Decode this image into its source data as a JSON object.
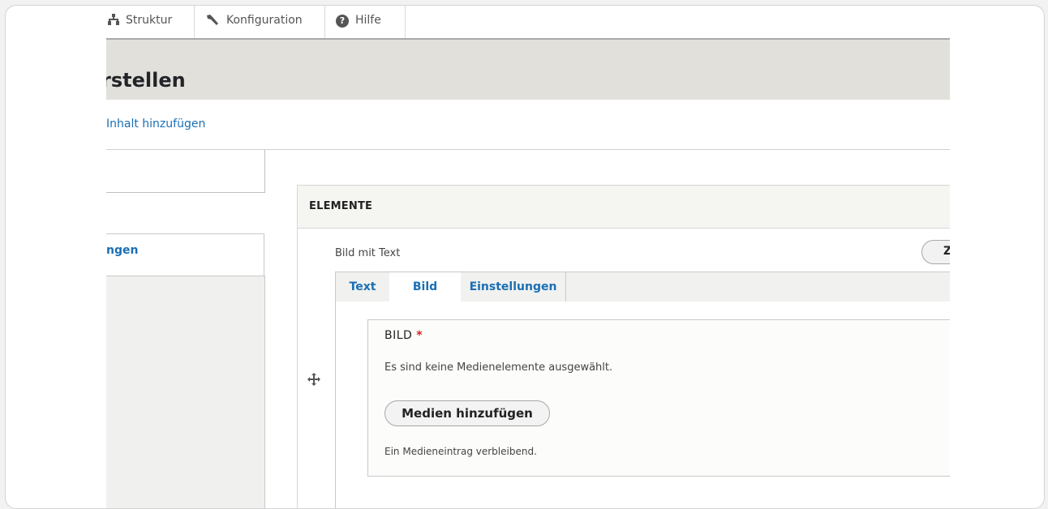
{
  "toolbar": {
    "struktur_label": "Struktur",
    "konfiguration_label": "Konfiguration",
    "hilfe_label": "Hilfe",
    "help_glyph": "?"
  },
  "page": {
    "title": "rstellen",
    "breadcrumb_link": "Inhalt hinzufügen"
  },
  "sidebar": {
    "active_tab_label": "ngen"
  },
  "elemente": {
    "header": "ELEMENTE",
    "widget_title": "Bild mit Text",
    "clipped_button_label": "Z",
    "tabs": [
      {
        "label": "Text"
      },
      {
        "label": "Bild"
      },
      {
        "label": "Einstellungen"
      }
    ],
    "bild": {
      "label": "BILD",
      "required_marker": "*",
      "empty_message": "Es sind keine Medienelemente ausgewählt.",
      "add_button": "Medien hinzufügen",
      "remaining": "Ein Medieneintrag verbleibend."
    }
  },
  "colors": {
    "link": "#1a6fb5",
    "required": "#d72222",
    "header_bg": "#e1e0da"
  }
}
